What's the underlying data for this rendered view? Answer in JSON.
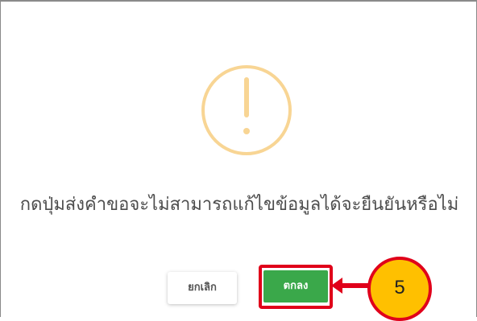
{
  "dialog": {
    "icon": "warning-exclamation-icon",
    "message": "กดปุ่มส่งคำขอจะไม่สามารถแก้ไขข้อมูลได้จะยืนยันหรือไม่",
    "cancel_label": "ยกเลิก",
    "confirm_label": "ตกลง"
  },
  "annotation": {
    "step_number": "5",
    "highlight_color": "#e0001a",
    "badge_color": "#ffc000"
  },
  "colors": {
    "warning_icon": "#f8d594",
    "confirm_button": "#3aa84a",
    "message_text": "#4d4d4d"
  }
}
